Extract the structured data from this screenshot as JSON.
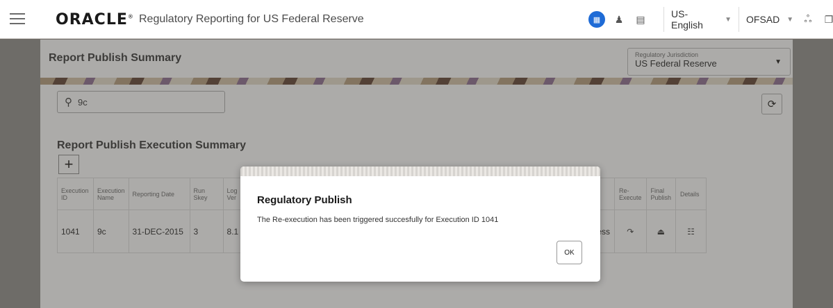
{
  "header": {
    "brand": "ORACLE",
    "brand_mark": "®",
    "app_title": "Regulatory Reporting for US Federal Reserve",
    "language": "US-English",
    "user": "OFSAD"
  },
  "page": {
    "title": "Report Publish Summary",
    "jurisdiction_label": "Regulatory Jurisdiction",
    "jurisdiction_value": "US Federal Reserve",
    "search_value": "9c",
    "section_title": "Report Publish Execution Summary"
  },
  "table": {
    "columns": [
      "Execution ID",
      "Execution Name",
      "Reporting Date",
      "Run Skey",
      "Log Ver"
    ],
    "right_columns": [
      "Re-Execute",
      "Final Publish",
      "Details"
    ],
    "row": {
      "execution_id": "1041",
      "execution_name": "9c",
      "reporting_date": "31-DEC-2015",
      "run_skey": "3",
      "log_ver": "8.1",
      "status_partial": "cess"
    }
  },
  "dialog": {
    "title": "Regulatory Publish",
    "message": "The Re-execution has been triggered succesfully for Execution ID 1041",
    "ok_label": "OK"
  },
  "icons": {
    "apps": "apps-grid-icon",
    "user_admin": "user-admin-icon",
    "doc": "document-icon",
    "refresh": "refresh-icon",
    "reexecute": "reexecute-icon",
    "publish": "publish-icon",
    "details": "details-icon"
  }
}
